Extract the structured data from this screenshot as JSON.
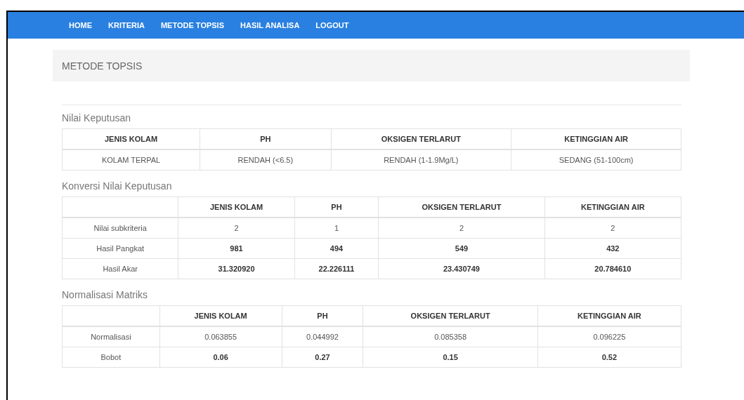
{
  "nav": [
    {
      "label": "HOME"
    },
    {
      "label": "KRITERIA"
    },
    {
      "label": "METODE TOPSIS"
    },
    {
      "label": "HASIL ANALISA"
    },
    {
      "label": "LOGOUT"
    }
  ],
  "panel": {
    "title": "METODE TOPSIS"
  },
  "sections": [
    {
      "title": "Nilai Keputusan",
      "columns": [
        "JENIS KOLAM",
        "PH",
        "OKSIGEN TERLARUT",
        "KETINGGIAN AIR"
      ],
      "rows": [
        {
          "cells": [
            "KOLAM TERPAL",
            "RENDAH (<6.5)",
            "RENDAH (1-1.9Mg/L)",
            "SEDANG (51-100cm)"
          ],
          "bold": false
        }
      ]
    },
    {
      "title": "Konversi Nilai Keputusan",
      "columns": [
        "JENIS KOLAM",
        "PH",
        "OKSIGEN TERLARUT",
        "KETINGGIAN AIR"
      ],
      "rows": [
        {
          "label": "Nilai subkriteria",
          "cells": [
            "2",
            "1",
            "2",
            "2"
          ],
          "bold": false
        },
        {
          "label": "Hasil Pangkat",
          "cells": [
            "981",
            "494",
            "549",
            "432"
          ],
          "bold": true
        },
        {
          "label": "Hasil Akar",
          "cells": [
            "31.320920",
            "22.226111",
            "23.430749",
            "20.784610"
          ],
          "bold": true
        }
      ]
    },
    {
      "title": "Normalisasi Matriks",
      "columns": [
        "JENIS KOLAM",
        "PH",
        "OKSIGEN TERLARUT",
        "KETINGGIAN AIR"
      ],
      "rows": [
        {
          "label": "Normalisasi",
          "cells": [
            "0.063855",
            "0.044992",
            "0.085358",
            "0.096225"
          ],
          "bold": false
        },
        {
          "label": "Bobot",
          "cells": [
            "0.06",
            "0.27",
            "0.15",
            "0.52"
          ],
          "bold": true
        }
      ]
    }
  ]
}
